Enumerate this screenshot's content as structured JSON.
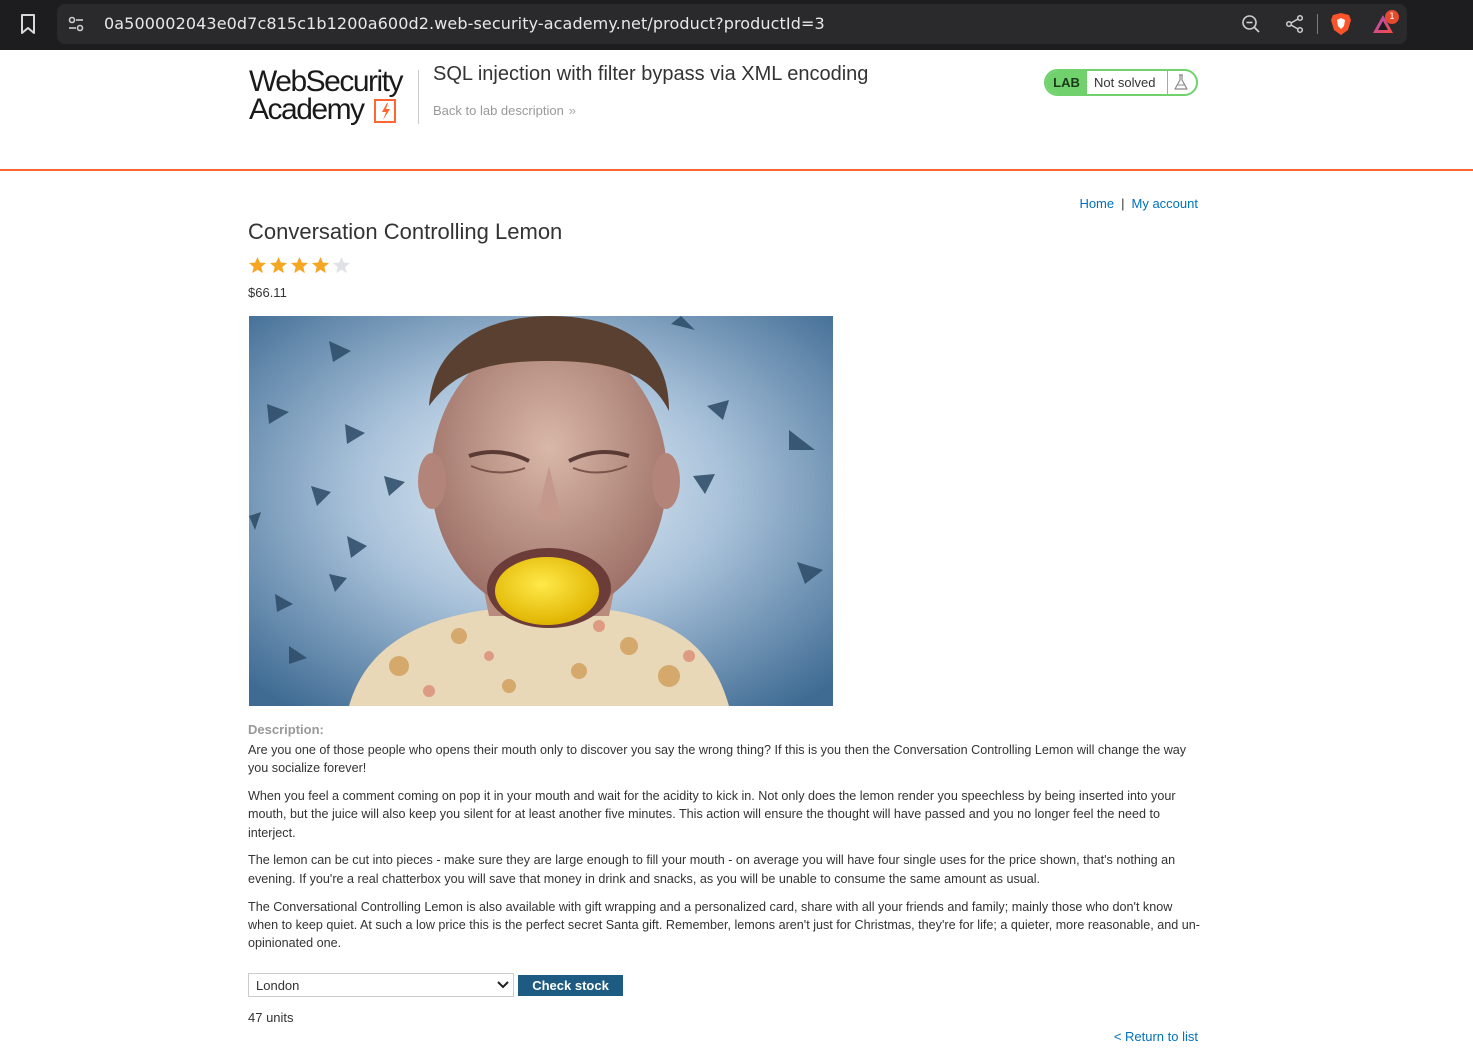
{
  "browser": {
    "url": "0a500002043e0d7c815c1b1200a600d2.web-security-academy.net/product?productId=3",
    "rewards_badge": "1"
  },
  "header": {
    "logo_line1": "WebSecurity",
    "logo_line2": "Academy",
    "lab_title": "SQL injection with filter bypass via XML encoding",
    "back_link": "Back to lab description",
    "lab_badge": "LAB",
    "lab_status": "Not solved"
  },
  "nav": {
    "home": "Home",
    "separator": "|",
    "account": "My account"
  },
  "product": {
    "title": "Conversation Controlling Lemon",
    "rating": 4,
    "rating_max": 5,
    "price": "$66.11",
    "description_label": "Description:",
    "description": [
      "Are you one of those people who opens their mouth only to discover you say the wrong thing? If this is you then the Conversation Controlling Lemon will change the way you socialize forever!",
      "When you feel a comment coming on pop it in your mouth and wait for the acidity to kick in. Not only does the lemon render you speechless by being inserted into your mouth, but the juice will also keep you silent for at least another five minutes. This action will ensure the thought will have passed and you no longer feel the need to interject.",
      "The lemon can be cut into pieces - make sure they are large enough to fill your mouth - on average you will have four single uses for the price shown, that's nothing an evening. If you're a real chatterbox you will save that money in drink and snacks, as you will be unable to consume the same amount as usual.",
      "The Conversational Controlling Lemon is also available with gift wrapping and a personalized card, share with all your friends and family; mainly those who don't know when to keep quiet. At such a low price this is the perfect secret Santa gift. Remember, lemons aren't just for Christmas, they're for life; a quieter, more reasonable, and un-opinionated one."
    ]
  },
  "stock": {
    "selected_store": "London",
    "button": "Check stock",
    "result": "47 units"
  },
  "footer": {
    "return_link": "< Return to list"
  },
  "colors": {
    "accent": "#ff6633",
    "link": "#0071bc",
    "button": "#1e5b82",
    "lab_green": "#70d16d",
    "star": "#f5a623"
  }
}
